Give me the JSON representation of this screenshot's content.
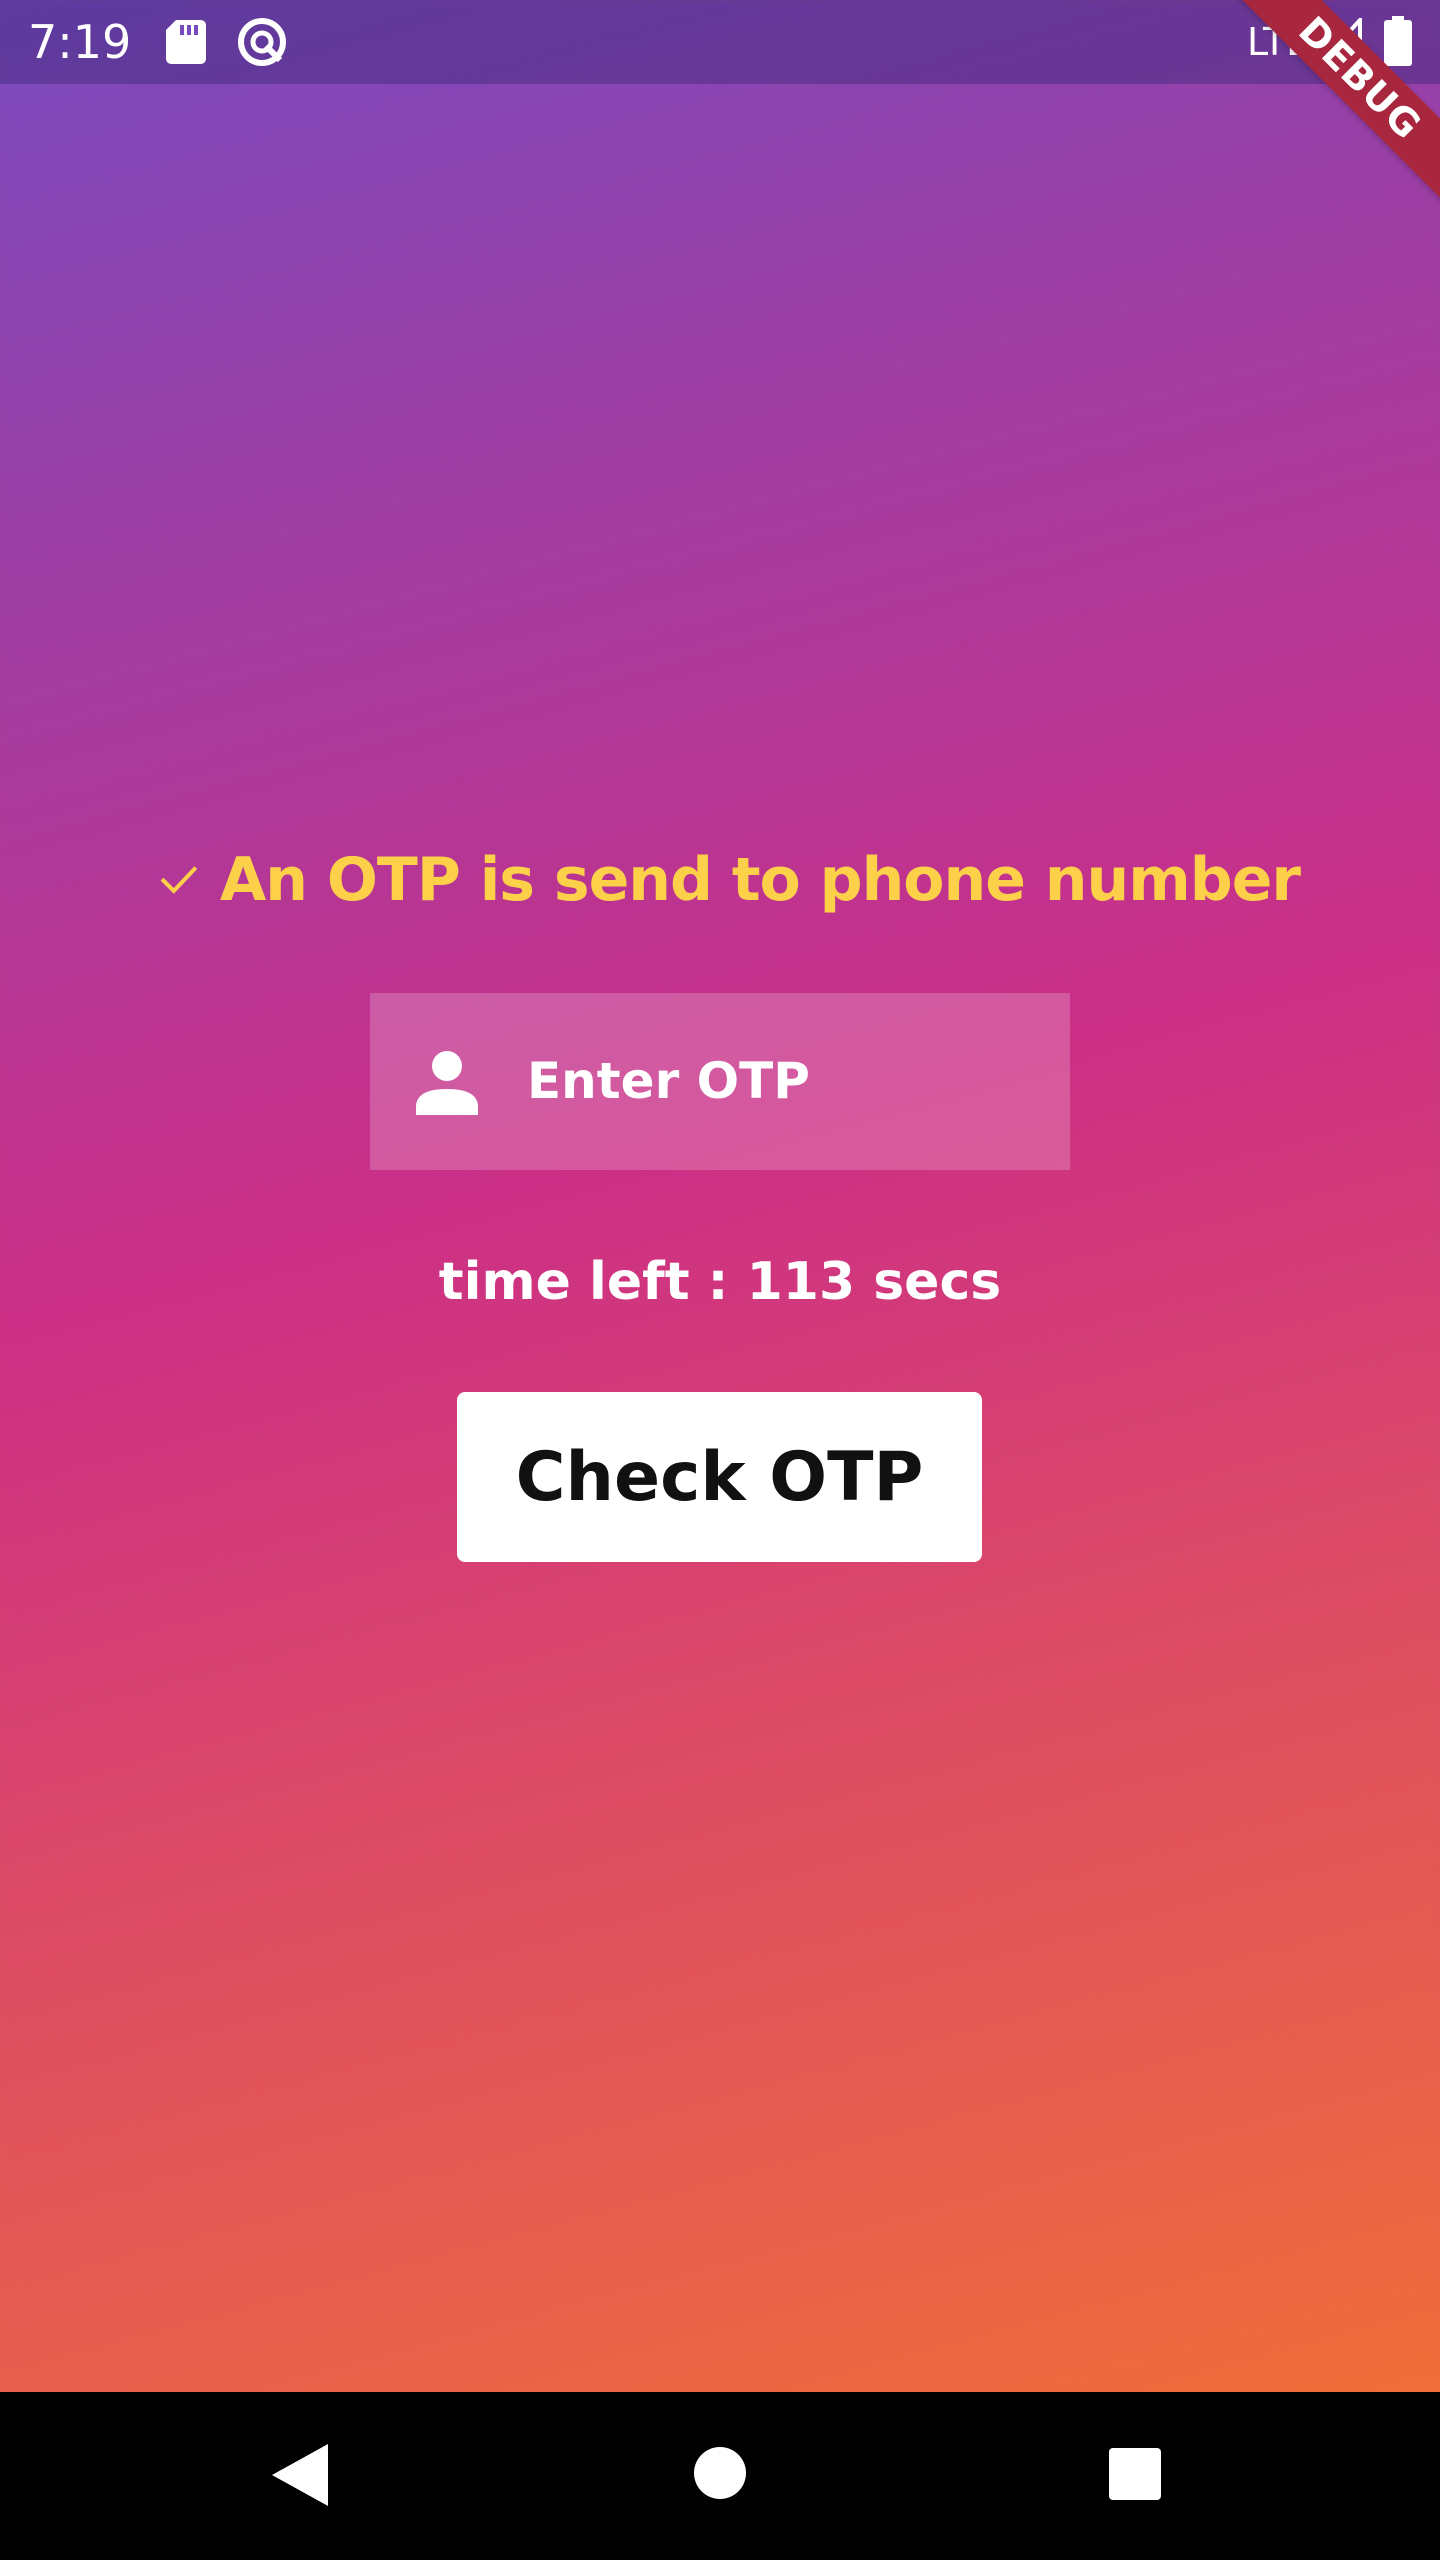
{
  "status_bar": {
    "time": "7:19",
    "network": "LTE",
    "icons": [
      "sd-card-icon",
      "sync-icon",
      "signal-icon",
      "battery-icon"
    ]
  },
  "debug_banner": {
    "label": "DEBUG"
  },
  "notice": {
    "icon": "check-icon",
    "text": "An OTP is send to phone number",
    "color": "#fdd04a"
  },
  "otp_field": {
    "icon": "person-icon",
    "placeholder": "Enter OTP",
    "value": ""
  },
  "timer": {
    "text": "time left : 113 secs"
  },
  "actions": {
    "check_label": "Check OTP"
  },
  "nav_bar": {
    "icons": [
      "back-icon",
      "home-icon",
      "recent-apps-icon"
    ]
  },
  "colors": {
    "gradient_top": "#7a4bbf",
    "gradient_middle": "#cc2f86",
    "gradient_bottom": "#f47530",
    "accent": "#fdd04a"
  }
}
